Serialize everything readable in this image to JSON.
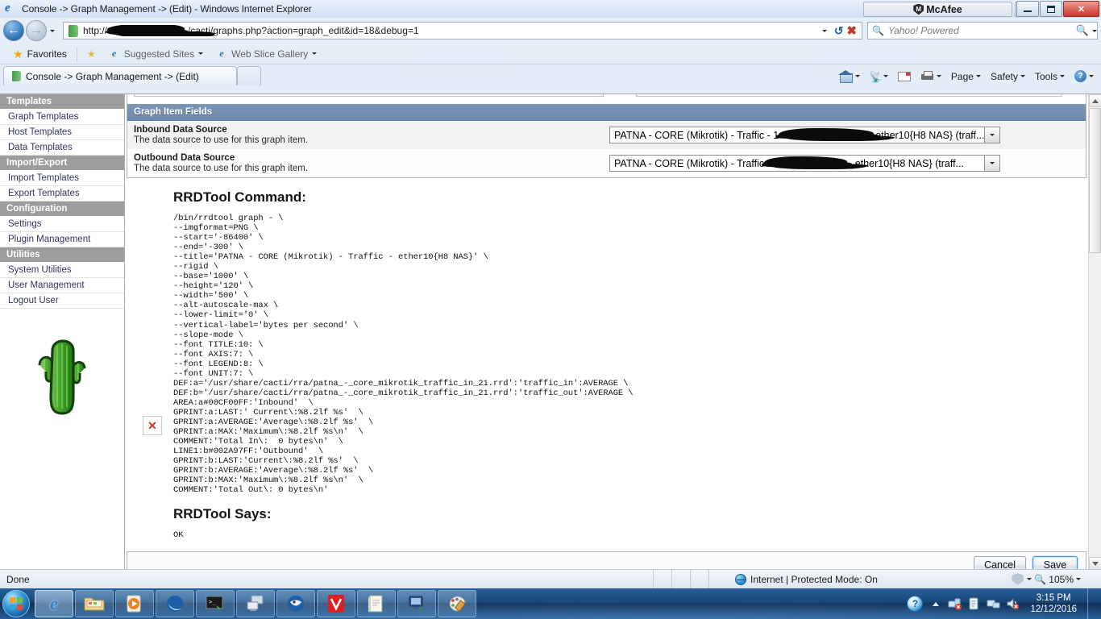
{
  "window": {
    "title": "Console -> Graph Management -> (Edit) - Windows Internet Explorer",
    "mcafee_label": "McAfee",
    "minimize": "Minimize",
    "maximize": "Maximize",
    "close": "✕"
  },
  "address": {
    "url_prefix": "http://",
    "url_suffix": "/cacti/graphs.php?action=graph_edit&id=18&debug=1",
    "search_placeholder": "Yahoo! Powered"
  },
  "favorites": {
    "favorites_label": "Favorites",
    "suggested_sites": "Suggested Sites",
    "web_slice_gallery": "Web Slice Gallery"
  },
  "tabs": [
    {
      "label": "Console -> Graph Management -> (Edit)"
    }
  ],
  "command_bar": {
    "page": "Page",
    "safety": "Safety",
    "tools": "Tools"
  },
  "sidebar": {
    "groups": [
      {
        "header": "Templates",
        "items": [
          {
            "label": "Graph Templates"
          },
          {
            "label": "Host Templates"
          },
          {
            "label": "Data Templates"
          }
        ]
      },
      {
        "header": "Import/Export",
        "items": [
          {
            "label": "Import Templates"
          },
          {
            "label": "Export Templates"
          }
        ]
      },
      {
        "header": "Configuration",
        "items": [
          {
            "label": "Settings"
          },
          {
            "label": "Plugin Management"
          }
        ]
      },
      {
        "header": "Utilities",
        "items": [
          {
            "label": "System Utilities"
          },
          {
            "label": "User Management"
          },
          {
            "label": "Logout User"
          }
        ]
      }
    ]
  },
  "panel": {
    "header": "Graph Item Fields",
    "rows": [
      {
        "title": "Inbound Data Source",
        "description": "The data source to use for this graph item.",
        "value_prefix": "PATNA - CORE (Mikrotik) - Traffic - 1",
        "value_suffix": "ether10{H8 NAS} (traff..."
      },
      {
        "title": "Outbound Data Source",
        "description": "The data source to use for this graph item.",
        "value_prefix": "PATNA - CORE (Mikrotik) - Traffic ",
        "value_suffix": "- ether10{H8 NAS} (traff..."
      }
    ]
  },
  "debug": {
    "command_heading": "RRDTool Command:",
    "command_text": "/bin/rrdtool graph - \\\n--imgformat=PNG \\\n--start='-86400' \\\n--end='-300' \\\n--title='PATNA - CORE (Mikrotik) - Traffic - ether10{H8 NAS}' \\\n--rigid \\\n--base='1000' \\\n--height='120' \\\n--width='500' \\\n--alt-autoscale-max \\\n--lower-limit='0' \\\n--vertical-label='bytes per second' \\\n--slope-mode \\\n--font TITLE:10: \\\n--font AXIS:7: \\\n--font LEGEND:8: \\\n--font UNIT:7: \\\nDEF:a='/usr/share/cacti/rra/patna_-_core_mikrotik_traffic_in_21.rrd':'traffic_in':AVERAGE \\\nDEF:b='/usr/share/cacti/rra/patna_-_core_mikrotik_traffic_in_21.rrd':'traffic_out':AVERAGE \\\nAREA:a#00CF00FF:'Inbound'  \\\nGPRINT:a:LAST:' Current\\:%8.2lf %s'  \\\nGPRINT:a:AVERAGE:'Average\\:%8.2lf %s'  \\\nGPRINT:a:MAX:'Maximum\\:%8.2lf %s\\n'  \\\nCOMMENT:'Total In\\:  0 bytes\\n'  \\\nLINE1:b#002A97FF:'Outbound'  \\\nGPRINT:b:LAST:'Current\\:%8.2lf %s'  \\\nGPRINT:b:AVERAGE:'Average\\:%8.2lf %s'  \\\nGPRINT:b:MAX:'Maximum\\:%8.2lf %s\\n'  \\\nCOMMENT:'Total Out\\: 0 bytes\\n'",
    "says_heading": "RRDTool Says:",
    "says_text": "OK",
    "broken_image_glyph": "✕"
  },
  "actions": {
    "cancel": "Cancel",
    "save": "Save"
  },
  "status_bar": {
    "status": "Done",
    "zone": "Internet | Protected Mode: On",
    "zoom": "105%"
  },
  "taskbar": {
    "time": "3:15 PM",
    "date": "12/12/2016",
    "help_glyph": "?"
  },
  "colors": {
    "panel_header": "#6d89ad",
    "nav_section": "#9d9d9d",
    "link": "#33355c",
    "accent_blue": "#1d5fa8",
    "mcafee_red": "#c8352b",
    "inbound_green": "#00CF00",
    "outbound_blue": "#002A97"
  }
}
